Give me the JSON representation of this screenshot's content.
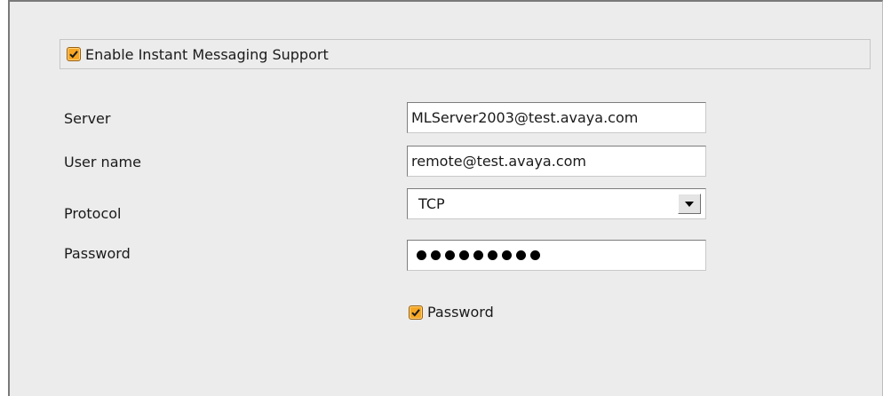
{
  "im_support": {
    "checkbox_label": "Enable Instant Messaging Support",
    "checked": true
  },
  "form": {
    "server_label": "Server",
    "server_value": "MLServer2003@test.avaya.com",
    "username_label": "User name",
    "username_value": "remote@test.avaya.com",
    "protocol_label": "Protocol",
    "protocol_value": "TCP",
    "password_label": "Password",
    "password_masked_length": 9,
    "remember_password_label": "Password",
    "remember_password_checked": true
  },
  "icons": {
    "checkbox": "checkmark-icon",
    "dropdown": "chevron-down-icon"
  },
  "colors": {
    "panel_bg": "#ececec",
    "checkbox_fill": "#f6a623",
    "field_bg": "#ffffff"
  }
}
